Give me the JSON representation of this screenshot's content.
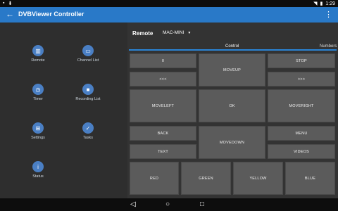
{
  "statusbar": {
    "time": "1:29"
  },
  "appbar": {
    "title": "DVBViewer Controller"
  },
  "sidebar": {
    "items": [
      {
        "label": "Remote"
      },
      {
        "label": "Channel List"
      },
      {
        "label": "Timer"
      },
      {
        "label": "Recording List"
      },
      {
        "label": "Settings"
      },
      {
        "label": "Tasks"
      },
      {
        "label": "Status"
      }
    ]
  },
  "main": {
    "title": "Remote",
    "device": "MAC-MINI",
    "tabs": [
      {
        "label": "Control"
      },
      {
        "label": "Numbers"
      }
    ],
    "buttons": {
      "b1": "II",
      "moveup": "MOVEUP",
      "stop": "STOP",
      "prev": "<<<",
      "next": ">>>",
      "moveleft": "MOVELEFT",
      "ok": "OK",
      "moveright": "MOVERIGHT",
      "back": "BACK",
      "movedown": "MOVEDOWN",
      "menu": "MENU",
      "text": "TEXT",
      "videos": "VIDEOS",
      "red": "RED",
      "green": "GREEN",
      "yellow": "YELLOW",
      "blue": "BLUE"
    }
  },
  "colors": {
    "accent": "#2979c8",
    "icon_circle": "#4a7fc4"
  }
}
